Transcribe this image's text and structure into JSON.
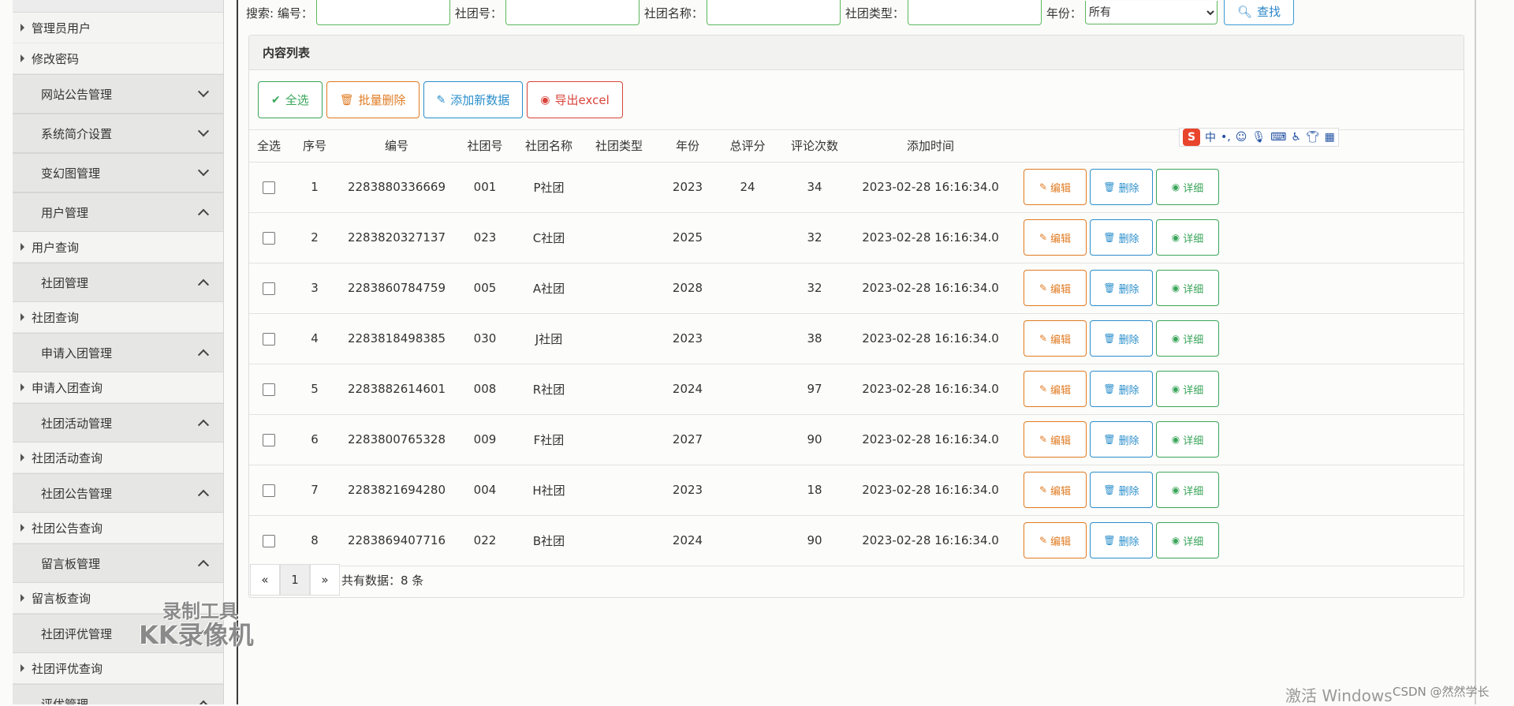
{
  "sidebar": {
    "items": [
      {
        "type": "link",
        "label": "管理员用户"
      },
      {
        "type": "link",
        "label": "修改密码"
      },
      {
        "type": "group",
        "label": "网站公告管理",
        "state": "collapsed"
      },
      {
        "type": "group",
        "label": "系统简介设置",
        "state": "collapsed"
      },
      {
        "type": "group",
        "label": "变幻图管理",
        "state": "collapsed"
      },
      {
        "type": "group",
        "label": "用户管理",
        "state": "expanded"
      },
      {
        "type": "link",
        "label": "用户查询"
      },
      {
        "type": "group",
        "label": "社团管理",
        "state": "expanded"
      },
      {
        "type": "link",
        "label": "社团查询"
      },
      {
        "type": "group",
        "label": "申请入团管理",
        "state": "expanded"
      },
      {
        "type": "link",
        "label": "申请入团查询"
      },
      {
        "type": "group",
        "label": "社团活动管理",
        "state": "expanded"
      },
      {
        "type": "link",
        "label": "社团活动查询"
      },
      {
        "type": "group",
        "label": "社团公告管理",
        "state": "expanded"
      },
      {
        "type": "link",
        "label": "社团公告查询"
      },
      {
        "type": "group",
        "label": "留言板管理",
        "state": "expanded"
      },
      {
        "type": "link",
        "label": "留言板查询"
      },
      {
        "type": "group",
        "label": "社团评优管理",
        "state": "expanded"
      },
      {
        "type": "link",
        "label": "社团评优查询"
      },
      {
        "type": "group",
        "label": "评优管理",
        "state": "expanded"
      }
    ]
  },
  "search": {
    "prefix": "搜索: 编号：",
    "club_no_label": "社团号：",
    "club_name_label": "社团名称：",
    "club_type_label": "社团类型：",
    "year_label": "年份：",
    "year_selected": "所有",
    "find_button": "查找"
  },
  "panel": {
    "title": "内容列表",
    "toolbar": {
      "select_all": "全选",
      "batch_delete": "批量删除",
      "add_new": "添加新数据",
      "export": "导出excel"
    }
  },
  "table": {
    "headers": [
      "全选",
      "序号",
      "编号",
      "社团号",
      "社团名称",
      "社团类型",
      "年份",
      "总评分",
      "评论次数",
      "添加时间",
      ""
    ],
    "rows": [
      {
        "idx": "1",
        "code": "2283880336669",
        "club_no": "001",
        "name": "P社团",
        "type": "",
        "year": "2023",
        "score": "24",
        "comments": "34",
        "time": "2023-02-28 16:16:34.0"
      },
      {
        "idx": "2",
        "code": "2283820327137",
        "club_no": "023",
        "name": "C社团",
        "type": "",
        "year": "2025",
        "score": "",
        "comments": "32",
        "time": "2023-02-28 16:16:34.0"
      },
      {
        "idx": "3",
        "code": "2283860784759",
        "club_no": "005",
        "name": "A社团",
        "type": "",
        "year": "2028",
        "score": "",
        "comments": "32",
        "time": "2023-02-28 16:16:34.0"
      },
      {
        "idx": "4",
        "code": "2283818498385",
        "club_no": "030",
        "name": "J社团",
        "type": "",
        "year": "2023",
        "score": "",
        "comments": "38",
        "time": "2023-02-28 16:16:34.0"
      },
      {
        "idx": "5",
        "code": "2283882614601",
        "club_no": "008",
        "name": "R社团",
        "type": "",
        "year": "2024",
        "score": "",
        "comments": "97",
        "time": "2023-02-28 16:16:34.0"
      },
      {
        "idx": "6",
        "code": "2283800765328",
        "club_no": "009",
        "name": "F社团",
        "type": "",
        "year": "2027",
        "score": "",
        "comments": "90",
        "time": "2023-02-28 16:16:34.0"
      },
      {
        "idx": "7",
        "code": "2283821694280",
        "club_no": "004",
        "name": "H社团",
        "type": "",
        "year": "2023",
        "score": "",
        "comments": "18",
        "time": "2023-02-28 16:16:34.0"
      },
      {
        "idx": "8",
        "code": "2283869407716",
        "club_no": "022",
        "name": "B社团",
        "type": "",
        "year": "2024",
        "score": "",
        "comments": "90",
        "time": "2023-02-28 16:16:34.0"
      }
    ],
    "row_actions": {
      "edit": "编辑",
      "delete": "删除",
      "detail": "详细"
    }
  },
  "pager": {
    "prev": "«",
    "page": "1",
    "next": "»",
    "total": "共有数据：8 条"
  },
  "ime": {
    "logo": "S",
    "mode": "中",
    "punct": "•,"
  },
  "overlay": {
    "watermark_line1": "录制工具",
    "watermark_line2": "KK录像机",
    "activate": "激活 Windows",
    "csdn": "CSDN @然然学长"
  },
  "colors": {
    "green": "#3aa55a",
    "orange": "#e07b22",
    "blue": "#2a8ecb",
    "red": "#d9443a"
  }
}
